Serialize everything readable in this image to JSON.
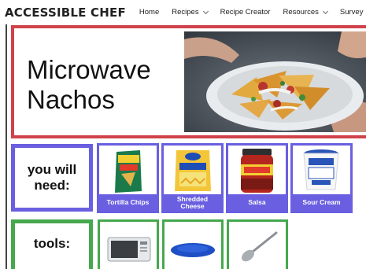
{
  "nav": {
    "brand": "ACCESSIBLE CHEF",
    "items": [
      {
        "label": "Home",
        "dropdown": false
      },
      {
        "label": "Recipes",
        "dropdown": true
      },
      {
        "label": "Recipe Creator",
        "dropdown": false
      },
      {
        "label": "Resources",
        "dropdown": true
      },
      {
        "label": "Survey",
        "dropdown": false
      }
    ]
  },
  "hero": {
    "title_line1": "Microwave",
    "title_line2": "Nachos",
    "photo": "nachos-plate-photo"
  },
  "ingredients": {
    "label_line1": "you will",
    "label_line2": "need:",
    "items": [
      {
        "caption": "Tortilla Chips",
        "icon": "tostitos-bag-image"
      },
      {
        "caption_line1": "Shredded",
        "caption_line2": "Cheese",
        "icon": "kraft-cheese-bag-image"
      },
      {
        "caption": "Salsa",
        "icon": "salsa-jar-image"
      },
      {
        "caption": "Sour Cream",
        "icon": "sour-cream-tub-image"
      }
    ]
  },
  "tools": {
    "label": "tools:",
    "items": [
      {
        "icon": "microwave-image"
      },
      {
        "icon": "blue-plate-image"
      },
      {
        "icon": "spoon-image"
      }
    ]
  },
  "colors": {
    "hero_border": "#d0424a",
    "need_border": "#6a5fe0",
    "tools_border": "#46a84e"
  }
}
